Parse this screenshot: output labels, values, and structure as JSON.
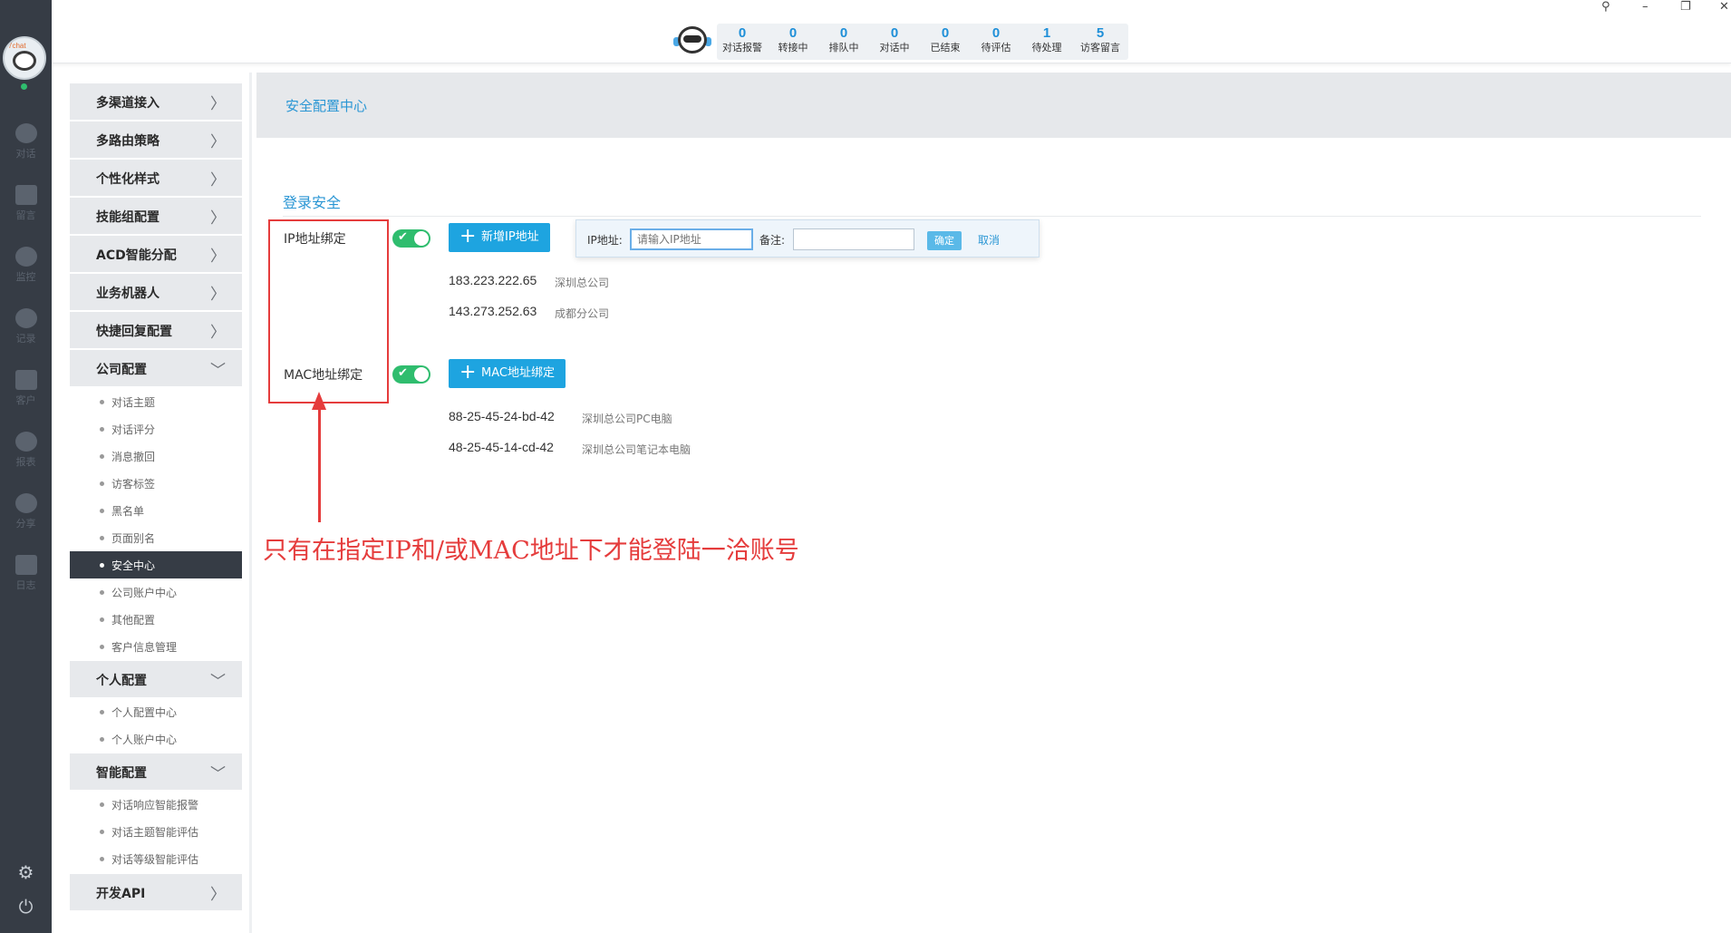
{
  "topbar": {
    "stats": [
      {
        "num": "0",
        "label": "对话报警"
      },
      {
        "num": "0",
        "label": "转接中"
      },
      {
        "num": "0",
        "label": "排队中"
      },
      {
        "num": "0",
        "label": "对话中"
      },
      {
        "num": "0",
        "label": "已结束"
      },
      {
        "num": "0",
        "label": "待评估"
      },
      {
        "num": "1",
        "label": "待处理"
      },
      {
        "num": "5",
        "label": "访客留言"
      }
    ]
  },
  "rail": {
    "brand_tag": "7chat",
    "items": [
      {
        "label": "对话",
        "icon": "chat-bubble-icon"
      },
      {
        "label": "留言",
        "icon": "mail-icon"
      },
      {
        "label": "监控",
        "icon": "eye-icon"
      },
      {
        "label": "记录",
        "icon": "clock-icon"
      },
      {
        "label": "客户",
        "icon": "contact-card-icon"
      },
      {
        "label": "报表",
        "icon": "pie-chart-icon"
      },
      {
        "label": "分享",
        "icon": "share-icon"
      },
      {
        "label": "日志",
        "icon": "clipboard-icon"
      }
    ]
  },
  "menu": {
    "groups": [
      {
        "label": "多渠道接入"
      },
      {
        "label": "多路由策略"
      },
      {
        "label": "个性化样式"
      },
      {
        "label": "技能组配置"
      },
      {
        "label": "ACD智能分配"
      },
      {
        "label": "业务机器人"
      },
      {
        "label": "快捷回复配置"
      },
      {
        "label": "公司配置"
      },
      {
        "label": "个人配置"
      },
      {
        "label": "智能配置"
      },
      {
        "label": "开发API"
      }
    ],
    "company_items": [
      "对话主题",
      "对话评分",
      "消息撤回",
      "访客标签",
      "黑名单",
      "页面别名",
      "安全中心",
      "公司账户中心",
      "其他配置",
      "客户信息管理"
    ],
    "personal_items": [
      "个人配置中心",
      "个人账户中心"
    ],
    "smart_items": [
      "对话响应智能报警",
      "对话主题智能评估",
      "对话等级智能评估"
    ]
  },
  "main": {
    "title": "安全配置中心",
    "section": "登录安全",
    "ip": {
      "label": "IP地址绑定",
      "enabled": true,
      "add_button": "新增IP地址",
      "popup": {
        "ip_label": "IP地址:",
        "ip_placeholder": "请输入IP地址",
        "note_label": "备注:",
        "note_value": "",
        "ok": "确定",
        "cancel": "取消"
      },
      "entries": [
        {
          "value": "183.223.222.65",
          "note": "深圳总公司"
        },
        {
          "value": "143.273.252.63",
          "note": "成都分公司"
        }
      ]
    },
    "mac": {
      "label": "MAC地址绑定",
      "enabled": true,
      "add_button": "MAC地址绑定",
      "entries": [
        {
          "value": "88-25-45-24-bd-42",
          "note": "深圳总公司PC电脑"
        },
        {
          "value": "48-25-45-14-cd-42",
          "note": "深圳总公司笔记本电脑"
        }
      ]
    }
  },
  "annotation": "只有在指定IP和/或MAC地址下才能登陆一洽账号",
  "colors": {
    "accent": "#1ea4e0",
    "annotation": "#e53c3c",
    "rail": "#363c45",
    "toggle_on": "#2fbd6e"
  }
}
